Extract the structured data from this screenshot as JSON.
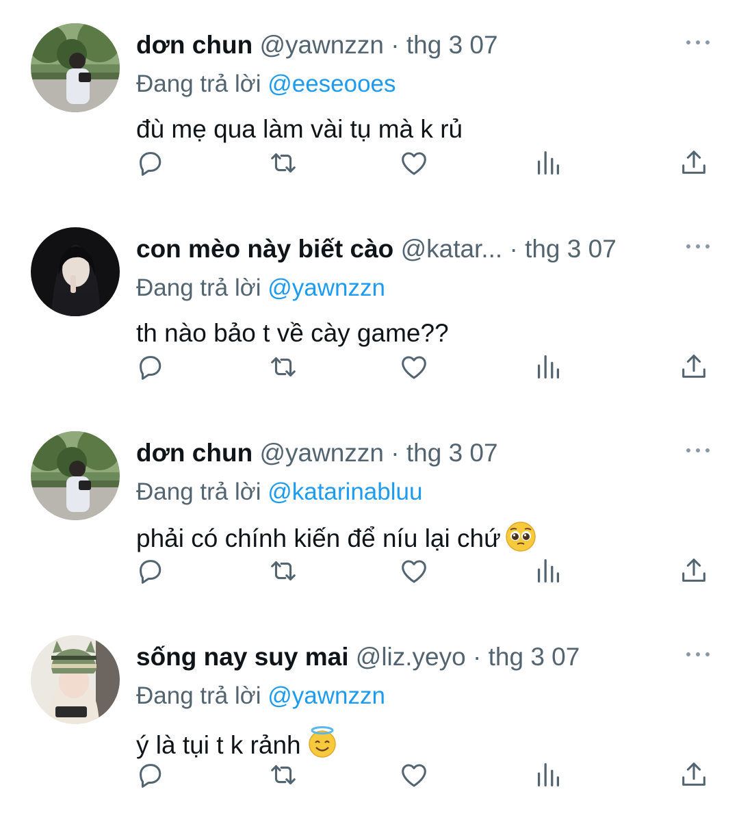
{
  "tweets": [
    {
      "name": "dơn chun",
      "handle": "@yawnzzn",
      "separator": "·",
      "time": "thg 3 07",
      "reply_prefix": "Đang trả lời",
      "reply_to": "@eeseooes",
      "text": "đù mẹ qua làm vài tụ mà k rủ",
      "emoji": "",
      "avatar": "park-photo"
    },
    {
      "name": "con mèo này biết cào",
      "handle": "@katar...",
      "separator": "·",
      "time": "thg 3 07",
      "reply_prefix": "Đang trả lời",
      "reply_to": "@yawnzzn",
      "text": "th nào bảo t về cày game??",
      "emoji": "",
      "avatar": "dark-portrait"
    },
    {
      "name": "dơn chun",
      "handle": "@yawnzzn",
      "separator": "·",
      "time": "thg 3 07",
      "reply_prefix": "Đang trả lời",
      "reply_to": "@katarinabluu",
      "text": "phải có chính kiến để níu lại chứ",
      "emoji": "pleading-face",
      "avatar": "park-photo"
    },
    {
      "name": "sống nay suy mai",
      "handle": "@liz.yeyo",
      "separator": "·",
      "time": "thg 3 07",
      "reply_prefix": "Đang trả lời",
      "reply_to": "@yawnzzn",
      "text": "ý là tụi t k rảnh",
      "emoji": "smiling-face-with-halo",
      "avatar": "knit-hat-portrait"
    }
  ],
  "actions": [
    "reply-icon",
    "retweet-icon",
    "like-icon",
    "views-icon",
    "share-icon"
  ],
  "colors": {
    "text": "#0f1419",
    "secondary": "#536471",
    "link": "#1d9bf0",
    "background": "#ffffff"
  }
}
